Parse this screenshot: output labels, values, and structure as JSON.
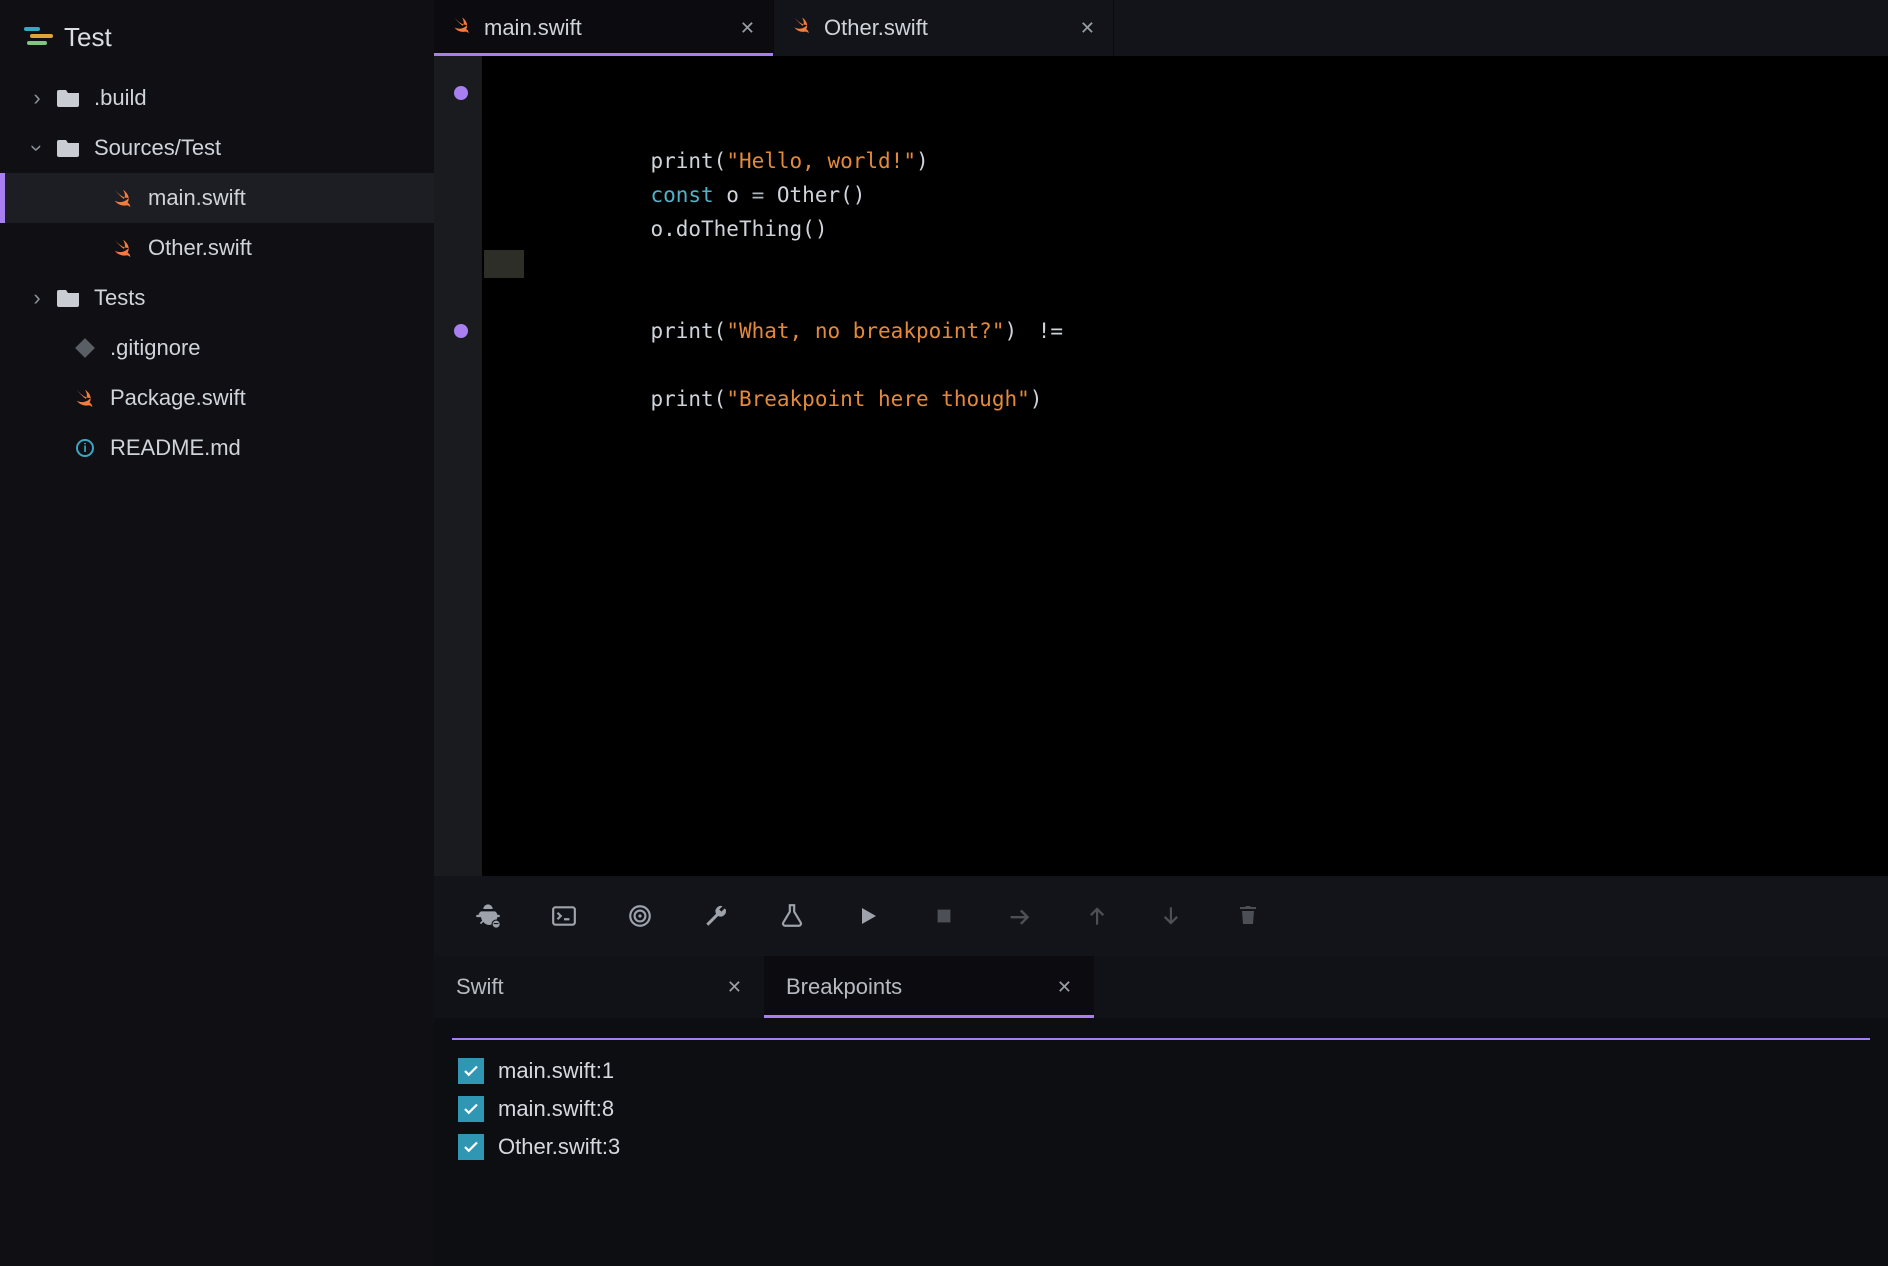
{
  "project": {
    "name": "Test"
  },
  "tree": {
    "build": ".build",
    "sources": "Sources/Test",
    "main": "main.swift",
    "other": "Other.swift",
    "tests": "Tests",
    "gitignore": ".gitignore",
    "pkg": "Package.swift",
    "readme": "README.md"
  },
  "tabs": {
    "main": "main.swift",
    "other": "Other.swift"
  },
  "code": {
    "l1_a": "print",
    "l1_b": "(",
    "l1_c": "\"Hello, world!\"",
    "l1_d": ")",
    "l3_a": "const",
    "l3_b": " o ",
    "l3_c": "=",
    "l3_d": " Other",
    "l3_e": "()",
    "l4_a": "o",
    "l4_b": ".doTheThing",
    "l4_c": "()",
    "l6_a": "print",
    "l6_b": "(",
    "l6_c": "\"What, no breakpoint?\"",
    "l6_d": ")",
    "l6_e": " !=",
    "l8_a": "print",
    "l8_b": "(",
    "l8_c": "\"Breakpoint here though\"",
    "l8_d": ")"
  },
  "bottom_tabs": {
    "swift": "Swift",
    "breakpoints": "Breakpoints"
  },
  "breakpoints": {
    "b1": "main.swift:1",
    "b2": "main.swift:8",
    "b3": "Other.swift:3"
  },
  "icons": {
    "debug": "debug",
    "console": "console",
    "target": "target",
    "wrench": "build",
    "flask": "test",
    "play": "play",
    "stop": "stop",
    "step_over": "step-over",
    "step_out": "step-out",
    "step_in": "step-in",
    "trash": "trash"
  }
}
